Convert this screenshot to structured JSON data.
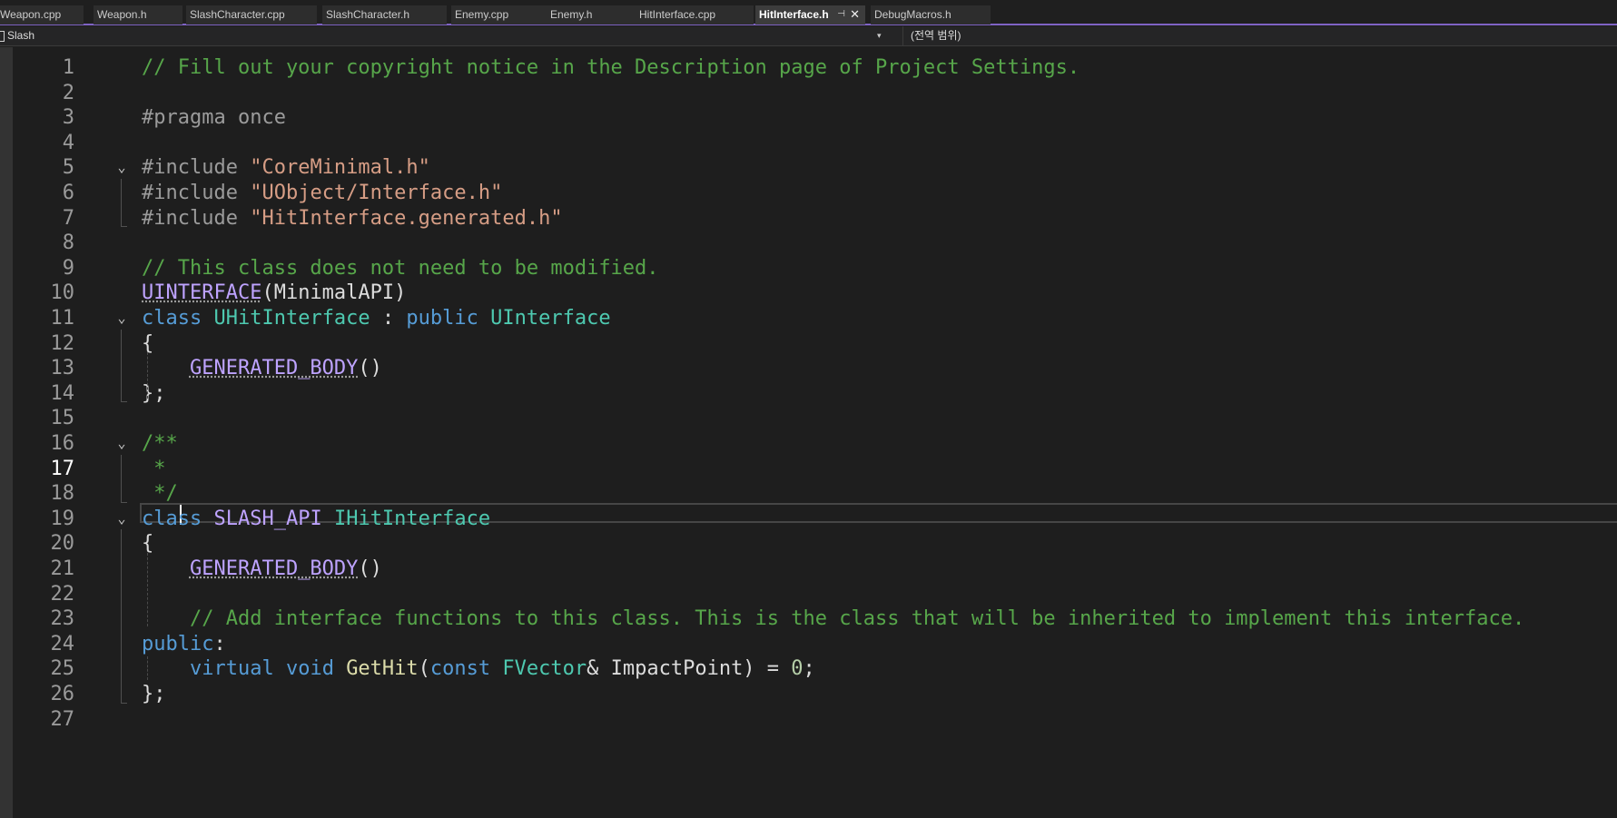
{
  "tabs": [
    {
      "label": "Weapon.cpp",
      "active": false
    },
    {
      "label": "Weapon.h",
      "active": false
    },
    {
      "label": "SlashCharacter.cpp",
      "active": false
    },
    {
      "label": "SlashCharacter.h",
      "active": false
    },
    {
      "label": "Enemy.cpp",
      "active": false
    },
    {
      "label": "Enemy.h",
      "active": false
    },
    {
      "label": "HitInterface.cpp",
      "active": false
    },
    {
      "label": "HitInterface.h",
      "active": true
    },
    {
      "label": "DebugMacros.h",
      "active": false
    }
  ],
  "active_tab": {
    "pin_icon": "pin-icon",
    "close_icon": "close-icon",
    "close_glyph": "✕",
    "pin_glyph": "⊣"
  },
  "navbar": {
    "project": "Slash",
    "scope": "(전역 범위)",
    "dropdown_glyph": "▾"
  },
  "editor": {
    "current_line": 17,
    "fold_glyph": "⌄",
    "lines": [
      {
        "n": "1",
        "text": "// Fill out your copyright notice in the Description page of Project Settings."
      },
      {
        "n": "2",
        "text": ""
      },
      {
        "n": "3",
        "text": "#pragma once"
      },
      {
        "n": "4",
        "text": ""
      },
      {
        "n": "5",
        "text": "#include \"CoreMinimal.h\""
      },
      {
        "n": "6",
        "text": "#include \"UObject/Interface.h\""
      },
      {
        "n": "7",
        "text": "#include \"HitInterface.generated.h\""
      },
      {
        "n": "8",
        "text": ""
      },
      {
        "n": "9",
        "text": "// This class does not need to be modified."
      },
      {
        "n": "10",
        "text": "UINTERFACE(MinimalAPI)"
      },
      {
        "n": "11",
        "text": "class UHitInterface : public UInterface"
      },
      {
        "n": "12",
        "text": "{"
      },
      {
        "n": "13",
        "text": "    GENERATED_BODY()"
      },
      {
        "n": "14",
        "text": "};"
      },
      {
        "n": "15",
        "text": ""
      },
      {
        "n": "16",
        "text": "/**"
      },
      {
        "n": "17",
        "text": " * "
      },
      {
        "n": "18",
        "text": " */"
      },
      {
        "n": "19",
        "text": "class SLASH_API IHitInterface"
      },
      {
        "n": "20",
        "text": "{"
      },
      {
        "n": "21",
        "text": "    GENERATED_BODY()"
      },
      {
        "n": "22",
        "text": ""
      },
      {
        "n": "23",
        "text": "    // Add interface functions to this class. This is the class that will be inherited to implement this interface."
      },
      {
        "n": "24",
        "text": "public:"
      },
      {
        "n": "25",
        "text": "    virtual void GetHit(const FVector& ImpactPoint) = 0;"
      },
      {
        "n": "26",
        "text": "};"
      },
      {
        "n": "27",
        "text": ""
      }
    ]
  },
  "colors": {
    "comment": "#57a64a",
    "keyword": "#569cd6",
    "type": "#4ec9b0",
    "string": "#d69d85",
    "macro": "#bea3ff",
    "function": "#dcdcaa",
    "preprocessor": "#9b9b9b",
    "accent": "#7f63c4"
  }
}
